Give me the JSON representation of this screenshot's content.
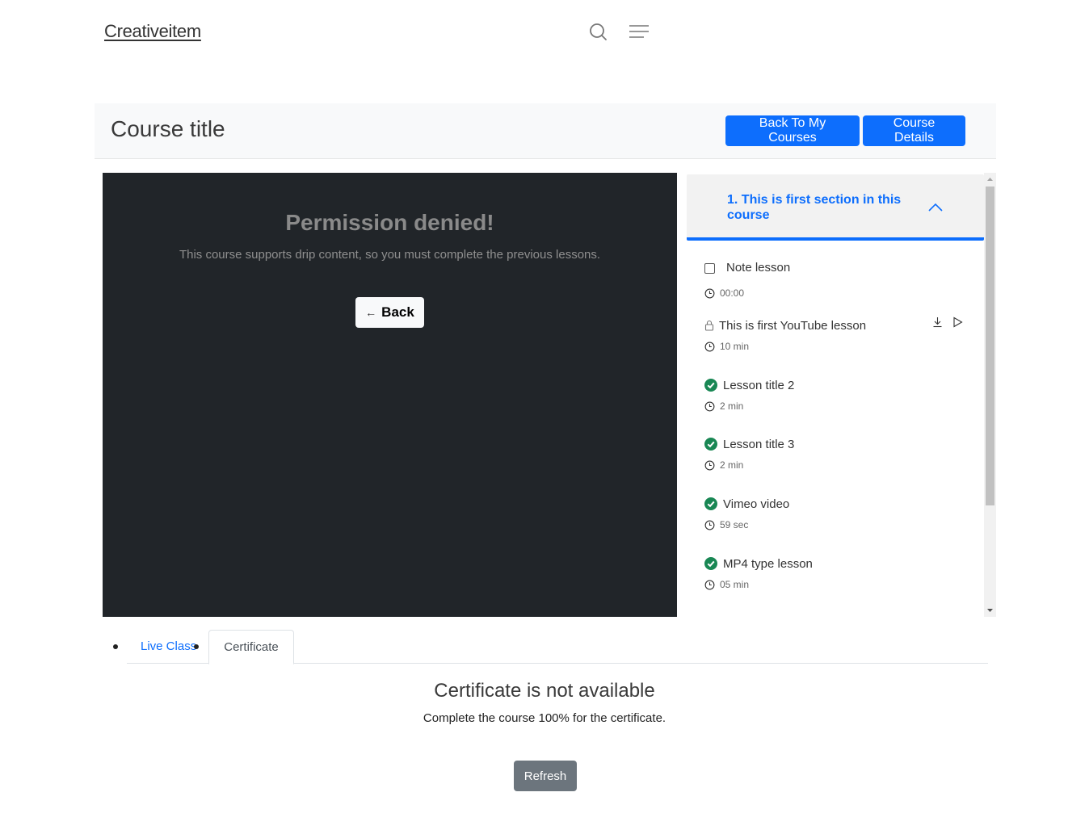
{
  "header": {
    "logo": "Creativeitem",
    "icons": [
      "search-icon",
      "menu-icon"
    ]
  },
  "course_bar": {
    "title": "Course title",
    "back_to_courses_label": "Back To My Courses",
    "course_details_label": "Course Details"
  },
  "player": {
    "title": "Permission denied!",
    "message": "This course supports drip content, so you must complete the previous lessons.",
    "back_label": "Back",
    "back_icon": "arrow-left-icon"
  },
  "sidebar": {
    "section_title": "1. This is first section in this course",
    "section_expanded": true,
    "lessons": [
      {
        "title": "Note lesson",
        "duration": "00:00",
        "status": "unchecked"
      },
      {
        "title": "This is first YouTube lesson",
        "duration": "10 min",
        "status": "locked",
        "actions": [
          "download-icon",
          "play-icon"
        ]
      },
      {
        "title": "Lesson title 2",
        "duration": "2 min",
        "status": "completed"
      },
      {
        "title": "Lesson title 3",
        "duration": "2 min",
        "status": "completed"
      },
      {
        "title": "Vimeo video",
        "duration": "59 sec",
        "status": "completed"
      },
      {
        "title": "MP4 type lesson",
        "duration": "05 min",
        "status": "completed"
      }
    ]
  },
  "tabs": {
    "items": [
      {
        "label": "Live Class",
        "active": false
      },
      {
        "label": "Certificate",
        "active": true
      }
    ]
  },
  "certificate": {
    "title": "Certificate is not available",
    "message": "Complete the course 100% for the certificate.",
    "refresh_label": "Refresh"
  },
  "colors": {
    "primary": "#0d6efd",
    "secondary": "#6c757d",
    "player_bg": "#212529",
    "success": "#198754",
    "section_bg": "#f2f2f2"
  }
}
